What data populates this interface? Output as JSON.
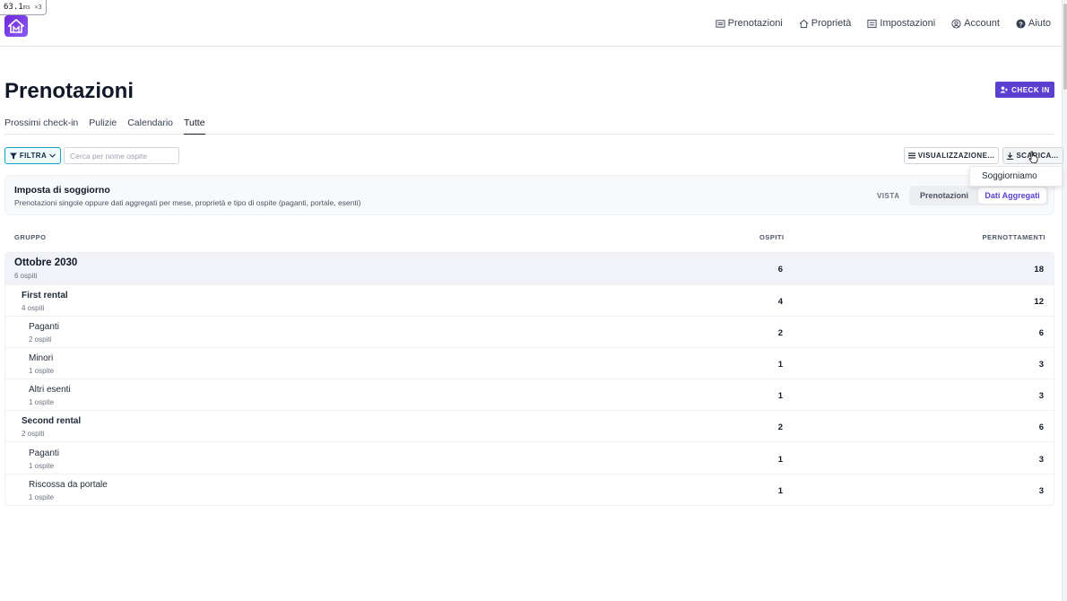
{
  "perf": {
    "value": "63.1",
    "unit": "ms ×3"
  },
  "nav": {
    "items": [
      {
        "label": "Prenotazioni",
        "icon": "list-icon"
      },
      {
        "label": "Proprietà",
        "icon": "home-icon"
      },
      {
        "label": "Impostazioni",
        "icon": "settings-icon"
      },
      {
        "label": "Account",
        "icon": "user-circle-icon"
      },
      {
        "label": "Aiuto",
        "icon": "help-icon"
      }
    ]
  },
  "header": {
    "title": "Prenotazioni",
    "checkin_label": "CHECK IN"
  },
  "tabs": [
    {
      "label": "Prossimi check-in",
      "active": false
    },
    {
      "label": "Pulizie",
      "active": false
    },
    {
      "label": "Calendario",
      "active": false
    },
    {
      "label": "Tutte",
      "active": true
    }
  ],
  "toolbar": {
    "filter_label": "FILTRA",
    "search_placeholder": "Cerca per nome ospite",
    "view_label": "VISUALIZZAZIONE...",
    "download_label": "SCARICA...",
    "dropdown_item": "Soggiorniamo"
  },
  "card": {
    "title": "Imposta di soggiorno",
    "subtitle": "Prenotazioni singole oppure dati aggregati per mese, proprietà e tipo di ospite (paganti, portale, esenti)",
    "vista_label": "VISTA",
    "toggle": {
      "first": "Prenotazioni",
      "second": "Dati Aggregati",
      "selected": "Dati Aggregati"
    }
  },
  "table": {
    "headers": {
      "group": "GRUPPO",
      "guests": "OSPITI",
      "nights": "PERNOTTAMENTI"
    },
    "rows": [
      {
        "level": 0,
        "name": "Ottobre 2030",
        "count": "6 ospiti",
        "guests": "6",
        "nights": "18"
      },
      {
        "level": 1,
        "name": "First rental",
        "count": "4 ospiti",
        "guests": "4",
        "nights": "12"
      },
      {
        "level": 2,
        "name": "Paganti",
        "count": "2 ospiti",
        "guests": "2",
        "nights": "6"
      },
      {
        "level": 2,
        "name": "Minori",
        "count": "1 ospite",
        "guests": "1",
        "nights": "3"
      },
      {
        "level": 2,
        "name": "Altri esenti",
        "count": "1 ospite",
        "guests": "1",
        "nights": "3"
      },
      {
        "level": 1,
        "name": "Second rental",
        "count": "2 ospiti",
        "guests": "2",
        "nights": "6"
      },
      {
        "level": 2,
        "name": "Paganti",
        "count": "1 ospite",
        "guests": "1",
        "nights": "3"
      },
      {
        "level": 2,
        "name": "Riscossa da portale",
        "count": "1 ospite",
        "guests": "1",
        "nights": "3"
      }
    ]
  },
  "colors": {
    "accent": "#5b3fd1",
    "filter_border": "#0ea5c9",
    "logo": "#7c3aed"
  }
}
